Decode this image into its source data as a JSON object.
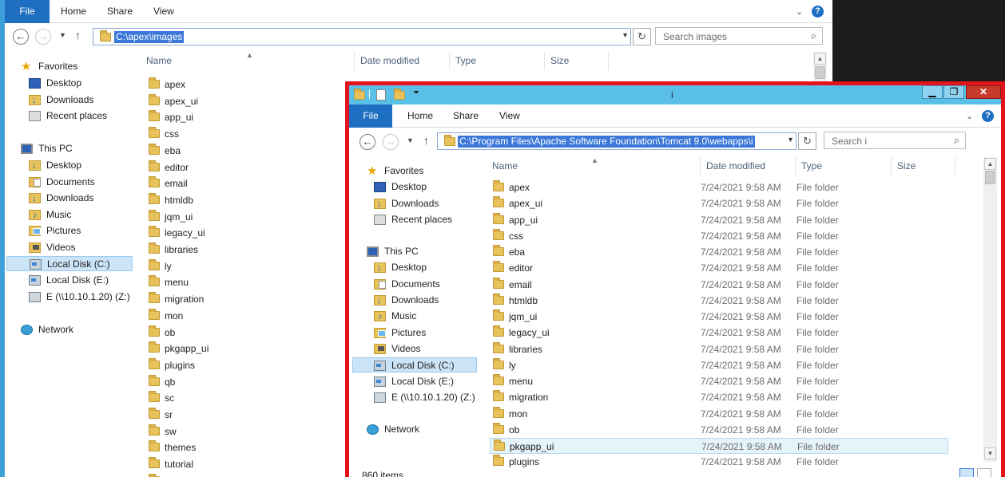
{
  "back_window": {
    "tabs": {
      "file": "File",
      "home": "Home",
      "share": "Share",
      "view": "View"
    },
    "address": "C:\\apex\\images",
    "search_placeholder": "Search images",
    "columns": {
      "name": "Name",
      "date": "Date modified",
      "type": "Type",
      "size": "Size"
    },
    "nav": {
      "favorites": "Favorites",
      "desktop": "Desktop",
      "downloads": "Downloads",
      "recent": "Recent places",
      "this_pc": "This PC",
      "pc_desktop": "Desktop",
      "documents": "Documents",
      "pc_downloads": "Downloads",
      "music": "Music",
      "pictures": "Pictures",
      "videos": "Videos",
      "local_c": "Local Disk (C:)",
      "local_e": "Local Disk (E:)",
      "net_z": "E (\\\\10.10.1.20) (Z:)",
      "network": "Network"
    },
    "files": [
      "apex",
      "apex_ui",
      "app_ui",
      "css",
      "eba",
      "editor",
      "email",
      "htmldb",
      "jqm_ui",
      "legacy_ui",
      "libraries",
      "ly",
      "menu",
      "migration",
      "mon",
      "ob",
      "pkgapp_ui",
      "plugins",
      "qb",
      "sc",
      "sr",
      "sw",
      "themes",
      "tutorial",
      "WEB-INF"
    ]
  },
  "front_window": {
    "title": "i",
    "tabs": {
      "file": "File",
      "home": "Home",
      "share": "Share",
      "view": "View"
    },
    "address": "C:\\Program Files\\Apache Software Foundation\\Tomcat 9.0\\webapps\\i",
    "search_placeholder": "Search i",
    "columns": {
      "name": "Name",
      "date": "Date modified",
      "type": "Type",
      "size": "Size"
    },
    "nav": {
      "favorites": "Favorites",
      "desktop": "Desktop",
      "downloads": "Downloads",
      "recent": "Recent places",
      "this_pc": "This PC",
      "pc_desktop": "Desktop",
      "documents": "Documents",
      "pc_downloads": "Downloads",
      "music": "Music",
      "pictures": "Pictures",
      "videos": "Videos",
      "local_c": "Local Disk (C:)",
      "local_e": "Local Disk (E:)",
      "net_z": "E (\\\\10.10.1.20) (Z:)",
      "network": "Network"
    },
    "rows": [
      {
        "name": "apex",
        "date": "7/24/2021 9:58 AM",
        "type": "File folder"
      },
      {
        "name": "apex_ui",
        "date": "7/24/2021 9:58 AM",
        "type": "File folder"
      },
      {
        "name": "app_ui",
        "date": "7/24/2021 9:58 AM",
        "type": "File folder"
      },
      {
        "name": "css",
        "date": "7/24/2021 9:58 AM",
        "type": "File folder"
      },
      {
        "name": "eba",
        "date": "7/24/2021 9:58 AM",
        "type": "File folder"
      },
      {
        "name": "editor",
        "date": "7/24/2021 9:58 AM",
        "type": "File folder"
      },
      {
        "name": "email",
        "date": "7/24/2021 9:58 AM",
        "type": "File folder"
      },
      {
        "name": "htmldb",
        "date": "7/24/2021 9:58 AM",
        "type": "File folder"
      },
      {
        "name": "jqm_ui",
        "date": "7/24/2021 9:58 AM",
        "type": "File folder"
      },
      {
        "name": "legacy_ui",
        "date": "7/24/2021 9:58 AM",
        "type": "File folder"
      },
      {
        "name": "libraries",
        "date": "7/24/2021 9:58 AM",
        "type": "File folder"
      },
      {
        "name": "ly",
        "date": "7/24/2021 9:58 AM",
        "type": "File folder"
      },
      {
        "name": "menu",
        "date": "7/24/2021 9:58 AM",
        "type": "File folder"
      },
      {
        "name": "migration",
        "date": "7/24/2021 9:58 AM",
        "type": "File folder"
      },
      {
        "name": "mon",
        "date": "7/24/2021 9:58 AM",
        "type": "File folder"
      },
      {
        "name": "ob",
        "date": "7/24/2021 9:58 AM",
        "type": "File folder"
      },
      {
        "name": "pkgapp_ui",
        "date": "7/24/2021 9:58 AM",
        "type": "File folder"
      },
      {
        "name": "plugins",
        "date": "7/24/2021 9:58 AM",
        "type": "File folder"
      }
    ],
    "status": "860 items"
  }
}
